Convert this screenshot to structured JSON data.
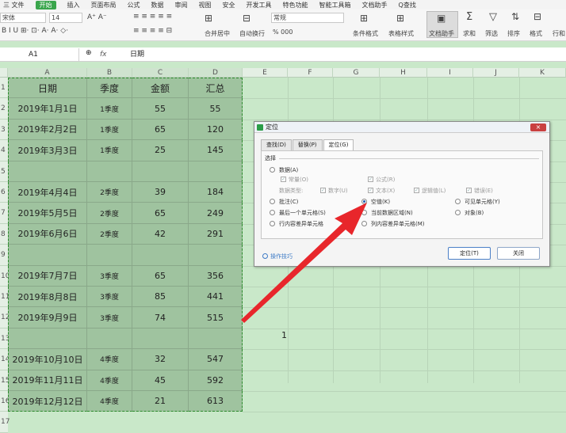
{
  "menu": {
    "file": "三 文件",
    "items": [
      "开始",
      "插入",
      "页面布局",
      "公式",
      "数据",
      "审阅",
      "视图",
      "安全",
      "开发工具",
      "特色功能",
      "智能工具箱",
      "文档助手",
      "Q查找"
    ]
  },
  "toolbar": {
    "font_name": "宋体",
    "font_size": "14",
    "merge_label": "合并居中",
    "wrap_label": "自动换行",
    "number_format": "常规",
    "percent_label": "% 000",
    "cond_format_label": "条件格式",
    "table_style_label": "表格样式",
    "doc_helper_label": "文档助手",
    "sum_label": "求和",
    "filter_label": "筛选",
    "sort_label": "排序",
    "format_label": "格式",
    "rowcol_label": "行和"
  },
  "formula_bar": {
    "cell_ref": "A1",
    "fx": "fx",
    "value": "日期"
  },
  "columns": [
    "A",
    "B",
    "C",
    "D",
    "E",
    "F",
    "G",
    "H",
    "I",
    "J",
    "K"
  ],
  "rows": [
    "1",
    "2",
    "3",
    "4",
    "5",
    "6",
    "7",
    "8",
    "9",
    "10",
    "11",
    "12",
    "13",
    "14",
    "15",
    "16",
    "17"
  ],
  "table": {
    "headers": [
      "日期",
      "季度",
      "金额",
      "汇总"
    ],
    "rows": [
      [
        "2019年1月1日",
        "1季度",
        "55",
        "55"
      ],
      [
        "2019年2月2日",
        "1季度",
        "65",
        "120"
      ],
      [
        "2019年3月3日",
        "1季度",
        "25",
        "145"
      ],
      [
        "",
        "",
        "",
        ""
      ],
      [
        "2019年4月4日",
        "2季度",
        "39",
        "184"
      ],
      [
        "2019年5月5日",
        "2季度",
        "65",
        "249"
      ],
      [
        "2019年6月6日",
        "2季度",
        "42",
        "291"
      ],
      [
        "",
        "",
        "",
        ""
      ],
      [
        "2019年7月7日",
        "3季度",
        "65",
        "356"
      ],
      [
        "2019年8月8日",
        "3季度",
        "85",
        "441"
      ],
      [
        "2019年9月9日",
        "3季度",
        "74",
        "515"
      ],
      [
        "",
        "",
        "",
        ""
      ],
      [
        "2019年10月10日",
        "4季度",
        "32",
        "547"
      ],
      [
        "2019年11月11日",
        "4季度",
        "45",
        "592"
      ],
      [
        "2019年12月12日",
        "4季度",
        "21",
        "613"
      ]
    ]
  },
  "stray_cell_value": "1",
  "dialog": {
    "title": "定位",
    "close": "×",
    "tabs": [
      "查找(D)",
      "替换(P)",
      "定位(G)"
    ],
    "group_label": "选择",
    "data_label": "数据(A)",
    "constant_label": "常量(O)",
    "formula_label": "公式(R)",
    "data_type_label": "数据类型:",
    "number_label": "数字(U)",
    "text_label": "文本(X)",
    "logical_label": "逻辑值(L)",
    "error_label": "错误(E)",
    "comment_label": "批注(C)",
    "blank_label": "空值(K)",
    "visible_label": "可见单元格(Y)",
    "last_cell_label": "最后一个单元格(S)",
    "current_region_label": "当前数据区域(N)",
    "object_label": "对象(B)",
    "row_diff_label": "行内容差异单元格",
    "col_diff_label": "列内容差异单元格(M)",
    "tip_label": "操作技巧",
    "ok_label": "定位(T)",
    "close_label": "关闭"
  },
  "colors": {
    "accent": "#3aa64c",
    "arrow": "#e8262b",
    "selection": "#9fc39f"
  }
}
